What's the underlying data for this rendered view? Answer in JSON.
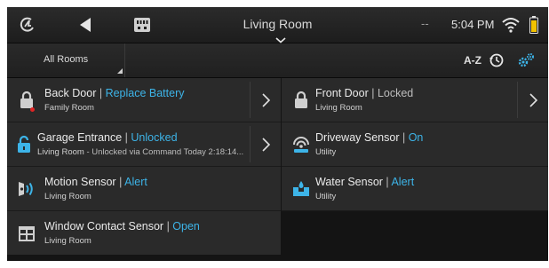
{
  "statusbar": {
    "room_title": "Living Room",
    "dash": "--",
    "time": "5:04 PM"
  },
  "filter": {
    "room_select": "All Rooms",
    "sort_label": "A-Z"
  },
  "devices": [
    {
      "name": "Back Door",
      "sep": " | ",
      "status": "Replace Battery",
      "room": "Family Room",
      "extra": "",
      "icon": "lock-icon"
    },
    {
      "name": "Front Door",
      "sep": " | ",
      "status": "Locked",
      "room": "Living Room",
      "extra": "",
      "icon": "lock-icon"
    },
    {
      "name": "Garage Entrance",
      "sep": " | ",
      "status": "Unlocked",
      "room": "Living Room",
      "extra": " - Unlocked via Command Today 2:18:14...",
      "icon": "unlocked-icon"
    },
    {
      "name": "Driveway Sensor",
      "sep": " | ",
      "status": "On",
      "room": "Utility",
      "extra": "",
      "icon": "driveway-sensor-icon"
    },
    {
      "name": "Motion Sensor",
      "sep": " | ",
      "status": "Alert",
      "room": "Living Room",
      "extra": "",
      "icon": "motion-sensor-icon"
    },
    {
      "name": "Water Sensor",
      "sep": " | ",
      "status": "Alert",
      "room": "Utility",
      "extra": "",
      "icon": "water-sensor-icon"
    },
    {
      "name": "Window Contact Sensor",
      "sep": " | ",
      "status": "Open",
      "room": "Living Room",
      "extra": "",
      "icon": "window-contact-icon"
    }
  ],
  "colors": {
    "accent": "#3db4e8",
    "alert_dot": "#e02424",
    "card_bg": "#2a2a2a"
  }
}
